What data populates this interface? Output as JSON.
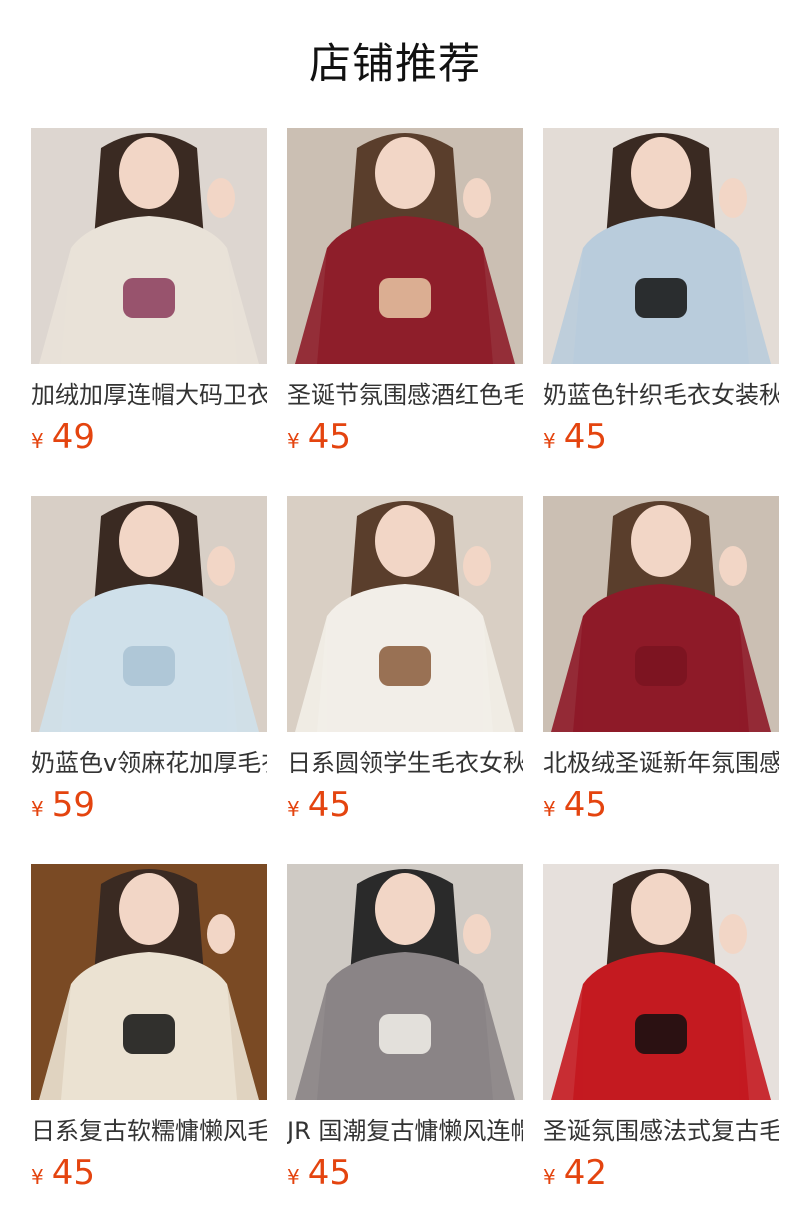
{
  "header": {
    "title": "店铺推荐"
  },
  "products": [
    {
      "name": "加绒加厚连帽大码卫衣",
      "currency": "¥",
      "price": "49",
      "image": "hoodie-beige-photo",
      "colors": {
        "bg": "#ddd6d0",
        "garment": "#e9e2d8",
        "accent": "#8a3a5a",
        "hair": "#3a2a22"
      }
    },
    {
      "name": "圣诞节氛围感酒红色毛衣",
      "currency": "¥",
      "price": "45",
      "image": "sweater-red-letters-photo",
      "colors": {
        "bg": "#cbbfb3",
        "garment": "#8e1e2a",
        "accent": "#e9c8a4",
        "hair": "#5a3e2c"
      }
    },
    {
      "name": "奶蓝色针织毛衣女装秋冬",
      "currency": "¥",
      "price": "45",
      "image": "sweater-blue-cat-photo",
      "colors": {
        "bg": "#e3dcd6",
        "garment": "#b9ccdc",
        "accent": "#111111",
        "hair": "#3a2a22"
      }
    },
    {
      "name": "奶蓝色v领麻花加厚毛衣",
      "currency": "¥",
      "price": "59",
      "image": "sweater-blue-cable-vneck-photo",
      "colors": {
        "bg": "#d8cfc6",
        "garment": "#cfe0ea",
        "accent": "#a9c2d4",
        "hair": "#3a2a22"
      }
    },
    {
      "name": "日系圆领学生毛衣女秋冬",
      "currency": "¥",
      "price": "45",
      "image": "sweater-white-bears-photo",
      "colors": {
        "bg": "#d9cfc4",
        "garment": "#f2eee8",
        "accent": "#8a5a3a",
        "hair": "#5a3e2c"
      }
    },
    {
      "name": "北极绒圣诞新年氛围感毛衣",
      "currency": "¥",
      "price": "45",
      "image": "sweater-red-plain-photo",
      "colors": {
        "bg": "#cbbfb3",
        "garment": "#8e1a28",
        "accent": "#7a1420",
        "hair": "#5a3e2c"
      }
    },
    {
      "name": "日系复古软糯慵懒风毛衣",
      "currency": "¥",
      "price": "45",
      "image": "sweater-cream-puppy-photo",
      "colors": {
        "bg": "#7a4a24",
        "garment": "#ebe2d2",
        "accent": "#111111",
        "hair": "#3a2a22"
      }
    },
    {
      "name": "JR 国潮复古慵懒风连帽卫衣",
      "currency": "¥",
      "price": "45",
      "image": "hoodie-grey-letter-photo",
      "colors": {
        "bg": "#cfcac4",
        "garment": "#8a8486",
        "accent": "#f2f0ea",
        "hair": "#2a2a2a"
      }
    },
    {
      "name": "圣诞氛围感法式复古毛衣",
      "currency": "¥",
      "price": "42",
      "image": "sweater-red-bow-skirt-photo",
      "colors": {
        "bg": "#e6e0dc",
        "garment": "#c41a20",
        "accent": "#111111",
        "hair": "#3a2a22"
      }
    }
  ]
}
